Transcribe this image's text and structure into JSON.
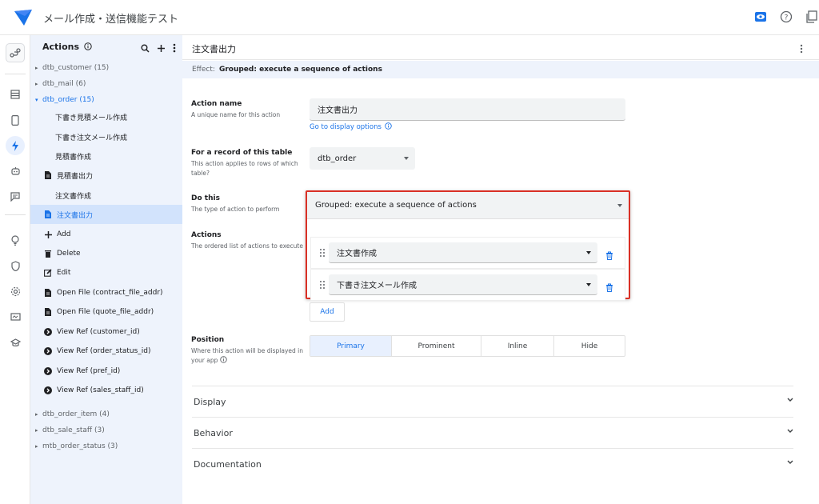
{
  "app": {
    "title": "メール作成・送信機能テスト"
  },
  "top_icons": [
    "eye-icon",
    "help-icon",
    "copy-icon"
  ],
  "sidebar": {
    "title": "Actions",
    "tables": [
      {
        "label": "dtb_customer (15)"
      },
      {
        "label": "dtb_mail (6)"
      },
      {
        "label": "dtb_order (15)"
      }
    ],
    "items": [
      {
        "label": "下書き見積メール作成",
        "icon": ""
      },
      {
        "label": "下書き注文メール作成",
        "icon": ""
      },
      {
        "label": "見積書作成",
        "icon": ""
      },
      {
        "label": "見積書出力",
        "icon": "file-icon"
      },
      {
        "label": "注文書作成",
        "icon": ""
      },
      {
        "label": "注文書出力",
        "icon": "file-icon"
      },
      {
        "label": "Add",
        "icon": "plus-icon"
      },
      {
        "label": "Delete",
        "icon": "trash-icon"
      },
      {
        "label": "Edit",
        "icon": "edit-icon"
      },
      {
        "label": "Open File (contract_file_addr)",
        "icon": "file-icon"
      },
      {
        "label": "Open File (quote_file_addr)",
        "icon": "file-icon"
      },
      {
        "label": "View Ref (customer_id)",
        "icon": "arrow-circle-icon"
      },
      {
        "label": "View Ref (order_status_id)",
        "icon": "arrow-circle-icon"
      },
      {
        "label": "View Ref (pref_id)",
        "icon": "arrow-circle-icon"
      },
      {
        "label": "View Ref (sales_staff_id)",
        "icon": "arrow-circle-icon"
      }
    ],
    "more_tables": [
      {
        "label": "dtb_order_item (4)"
      },
      {
        "label": "dtb_sale_staff (3)"
      },
      {
        "label": "mtb_order_status (3)"
      }
    ]
  },
  "main": {
    "title": "注文書出力",
    "effect_label": "Effect:",
    "effect_value": "Grouped: execute a sequence of actions",
    "action_name": {
      "label": "Action name",
      "desc": "A unique name for this action",
      "value": "注文書出力",
      "link": "Go to display options"
    },
    "record": {
      "label": "For a record of this table",
      "desc": "This action applies to rows of which table?",
      "value": "dtb_order"
    },
    "do_this": {
      "label": "Do this",
      "desc": "The type of action to perform",
      "value": "Grouped: execute a sequence of actions"
    },
    "actions": {
      "label": "Actions",
      "desc": "The ordered list of actions to execute",
      "items": [
        "注文書作成",
        "下書き注文メール作成"
      ],
      "add": "Add"
    },
    "position": {
      "label": "Position",
      "desc": "Where this action will be displayed in your app",
      "options": [
        "Primary",
        "Prominent",
        "Inline",
        "Hide"
      ],
      "selected": "Primary"
    },
    "sections": [
      "Display",
      "Behavior",
      "Documentation"
    ]
  },
  "colors": {
    "accent": "#1a73e8",
    "highlight": "#d93025",
    "sidebar_bg": "#eef3fc"
  }
}
